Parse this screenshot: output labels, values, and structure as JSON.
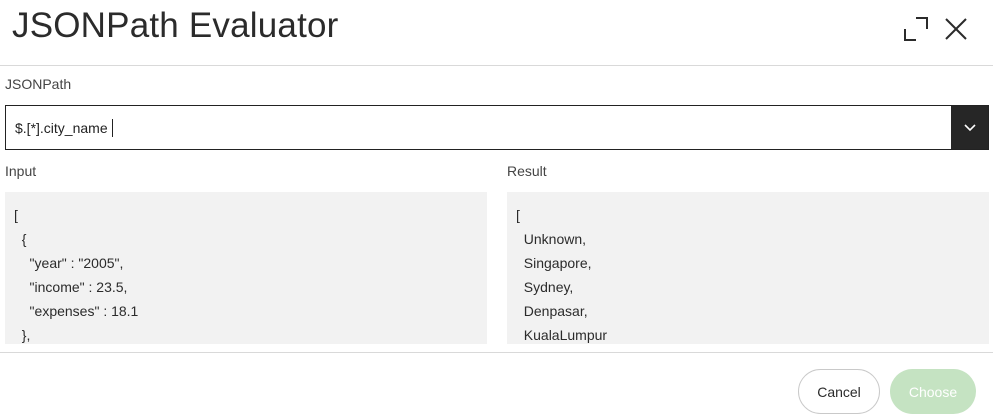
{
  "dialog": {
    "title": "JSONPath Evaluator",
    "icons": {
      "expand": "expand-icon",
      "close": "close-icon",
      "dropdown": "chevron-down-icon"
    }
  },
  "jsonpath": {
    "label": "JSONPath",
    "value": "$.[*].city_name"
  },
  "input": {
    "label": "Input",
    "lines": [
      "[",
      "  {",
      "    \"year\" : \"2005\",",
      "    \"income\" : 23.5,",
      "    \"expenses\" : 18.1",
      "  },"
    ]
  },
  "result": {
    "label": "Result",
    "lines": [
      "[",
      "  Unknown,",
      "  Singapore,",
      "  Sydney,",
      "  Denpasar,",
      "  KualaLumpur"
    ]
  },
  "footer": {
    "cancel_label": "Cancel",
    "choose_label": "Choose"
  },
  "colors": {
    "dropdown_bg": "#262626",
    "panel_bg": "#f2f2f2",
    "choose_disabled": "#c5e3c2"
  }
}
